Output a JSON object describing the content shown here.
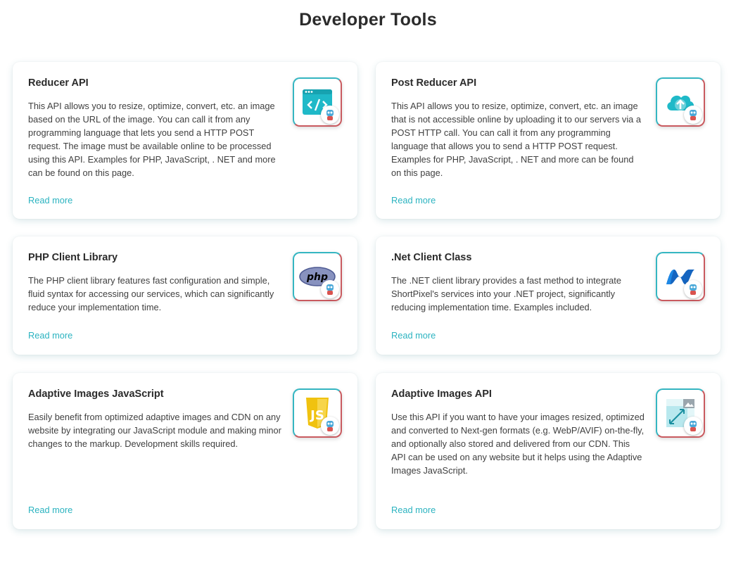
{
  "page": {
    "title": "Developer Tools"
  },
  "cards": [
    {
      "title": "Reducer API",
      "description": "This API allows you to resize, optimize, convert, etc. an image based on the URL of the image. You can call it from any programming language that lets you send a HTTP POST request. The image must be available online to be processed using this API. Examples for PHP, JavaScript, . NET and more can be found on this page.",
      "link": "Read more",
      "icon": "browser-code-icon"
    },
    {
      "title": "Post Reducer API",
      "description": "This API allows you to resize, optimize, convert, etc. an image that is not accessible online by uploading it to our servers via a POST HTTP call. You can call it from any programming language that allows you to send a HTTP POST request. Examples for PHP, JavaScript, . NET and more can be found on this page.",
      "link": "Read more",
      "icon": "cloud-upload-icon"
    },
    {
      "title": "PHP Client Library",
      "description": "The PHP client library features fast configuration and simple, fluid syntax for accessing our services, which can significantly reduce your implementation time.",
      "link": "Read more",
      "icon": "php-logo-icon",
      "icon_text": "php"
    },
    {
      "title": ".Net Client Class",
      "description": "The .NET client library provides a fast method to integrate ShortPixel's services into your .NET project, significantly reducing implementation time. Examples included.",
      "link": "Read more",
      "icon": "dotnet-logo-icon"
    },
    {
      "title": "Adaptive Images JavaScript",
      "description": "Easily benefit from optimized adaptive images and CDN on any website by integrating our JavaScript module and making minor changes to the markup. Development skills required.",
      "link": "Read more",
      "icon": "js-logo-icon",
      "icon_text": "JS"
    },
    {
      "title": "Adaptive Images API",
      "description": "Use this API if you want to have your images resized, optimized and converted to Next-gen formats (e.g. WebP/AVIF) on-the-fly, and optionally also stored and delivered from our CDN. This API can be used on any website but it helps using the Adaptive Images JavaScript.",
      "link": "Read more",
      "icon": "image-resize-icon"
    }
  ],
  "colors": {
    "accent": "#2bb3c0",
    "tile_border_top": "#35b6c2",
    "tile_border_bottom": "#c95a5f",
    "title": "#2b2b2b",
    "text": "#404040"
  }
}
